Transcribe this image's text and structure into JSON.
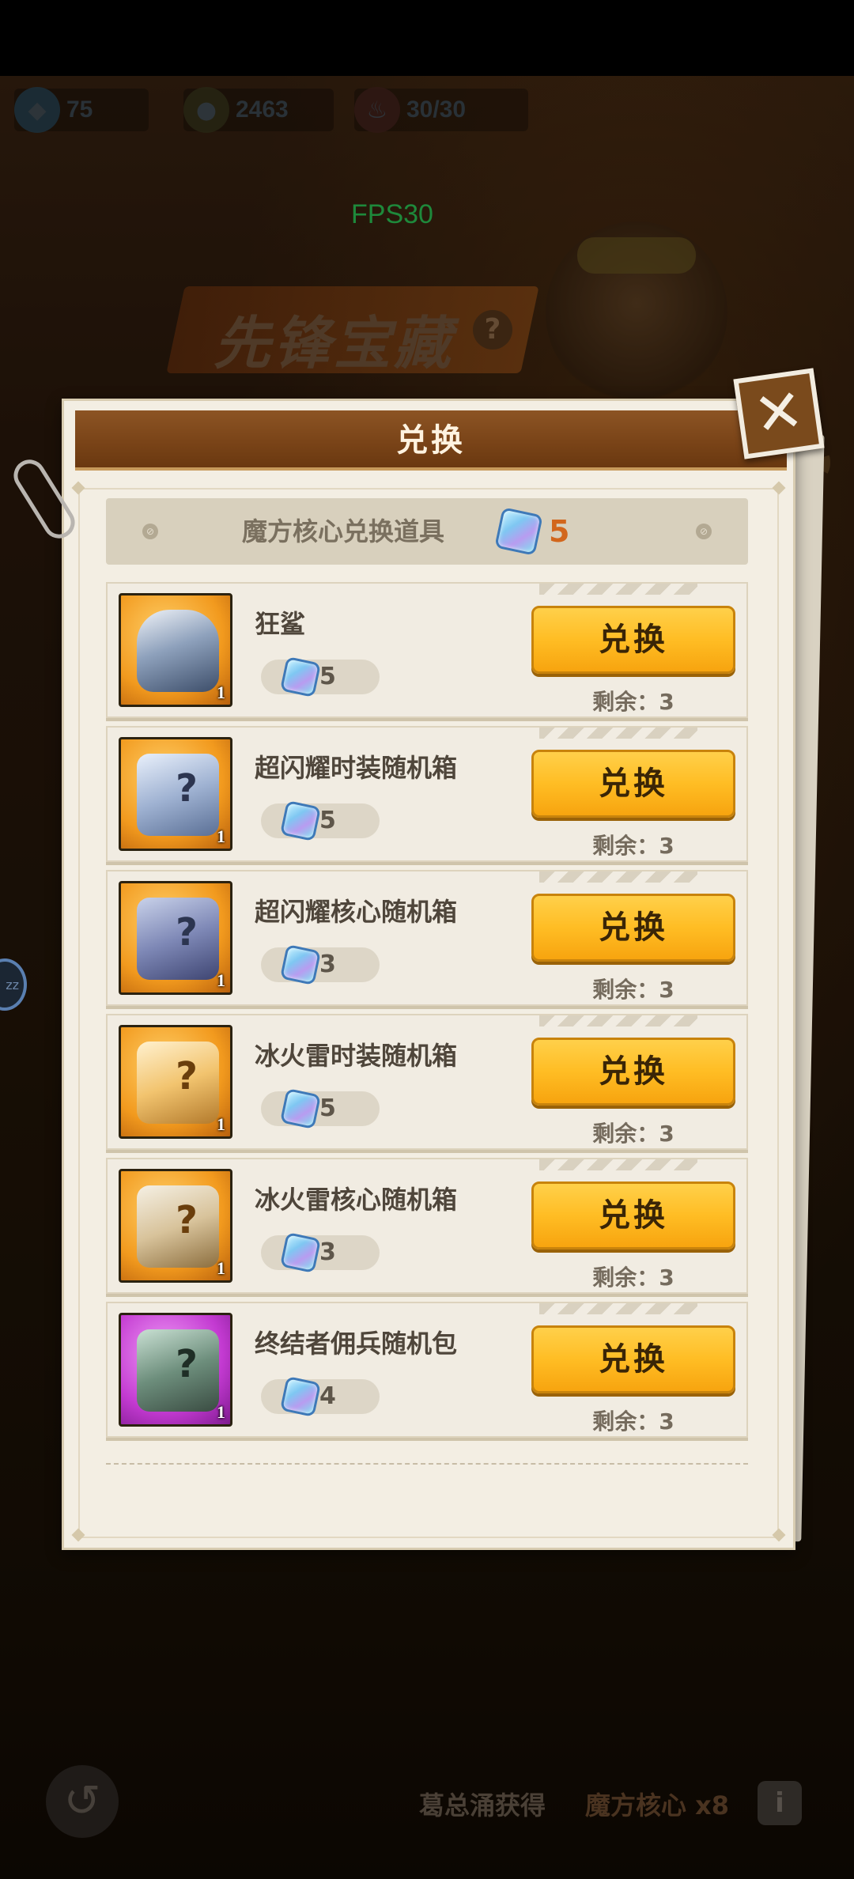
{
  "resources": [
    {
      "icon": "gem-icon",
      "value": "75"
    },
    {
      "icon": "coin-icon",
      "value": "2463"
    },
    {
      "icon": "meat-icon",
      "value": "30/30"
    }
  ],
  "fps": "FPS30",
  "event": {
    "title": "先锋宝藏",
    "help": "?"
  },
  "modal": {
    "title": "兑换",
    "close_glyph": "✕",
    "subheader": {
      "label": "魔方核心兑换道具",
      "currency_icon": "cube-icon",
      "count": "5"
    }
  },
  "items": [
    {
      "name": "狂鲨",
      "cost": "5",
      "quantity": "1",
      "button": "兑换",
      "remaining": "剩余：3",
      "icon": "mech-shark-icon",
      "frame": "orange"
    },
    {
      "name": "超闪耀时装随机箱",
      "cost": "5",
      "quantity": "1",
      "button": "兑换",
      "remaining": "剩余：3",
      "icon": "gift-box-icon",
      "frame": "orange"
    },
    {
      "name": "超闪耀核心随机箱",
      "cost": "3",
      "quantity": "1",
      "button": "兑换",
      "remaining": "剩余：3",
      "icon": "chest-icon",
      "frame": "orange"
    },
    {
      "name": "冰火雷时装随机箱",
      "cost": "5",
      "quantity": "1",
      "button": "兑换",
      "remaining": "剩余：3",
      "icon": "elemental-gift-icon",
      "frame": "orange"
    },
    {
      "name": "冰火雷核心随机箱",
      "cost": "3",
      "quantity": "1",
      "button": "兑换",
      "remaining": "剩余：3",
      "icon": "elemental-chest-icon",
      "frame": "orange"
    },
    {
      "name": "终结者佣兵随机包",
      "cost": "4",
      "quantity": "1",
      "button": "兑换",
      "remaining": "剩余：3",
      "icon": "mercenary-pack-icon",
      "frame": "purple"
    }
  ],
  "footer": {
    "label": "葛总涌获得",
    "value": "魔方核心 x8",
    "info": "i",
    "back": "↺"
  },
  "side_badge": "zz",
  "colors": {
    "accent": "#ffbd24",
    "header": "#7a4418",
    "count": "#d2661c",
    "fps": "#2fd35b"
  }
}
